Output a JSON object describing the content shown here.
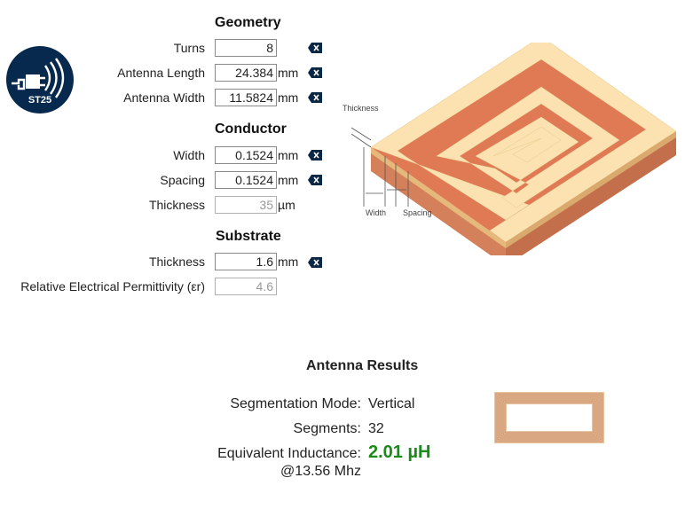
{
  "logo": {
    "text": "ST25"
  },
  "geometry": {
    "title": "Geometry",
    "turns": {
      "label": "Turns",
      "value": "8"
    },
    "length": {
      "label": "Antenna Length",
      "value": "24.384",
      "unit": "mm"
    },
    "width": {
      "label": "Antenna Width",
      "value": "11.5824",
      "unit": "mm"
    }
  },
  "conductor": {
    "title": "Conductor",
    "width": {
      "label": "Width",
      "value": "0.1524",
      "unit": "mm"
    },
    "spacing": {
      "label": "Spacing",
      "value": "0.1524",
      "unit": "mm"
    },
    "thickness": {
      "label": "Thickness",
      "value": "35",
      "unit": "µm"
    }
  },
  "substrate": {
    "title": "Substrate",
    "thickness": {
      "label": "Thickness",
      "value": "1.6",
      "unit": "mm"
    },
    "permittivity": {
      "label": "Relative Electrical Permittivity (εr)",
      "value": "4.6"
    }
  },
  "diagram": {
    "thickness_label": "Thickness",
    "width_label": "Width",
    "spacing_label": "Spacing"
  },
  "results": {
    "title": "Antenna Results",
    "segmentation_mode": {
      "label": "Segmentation Mode:",
      "value": "Vertical"
    },
    "segments": {
      "label": "Segments:",
      "value": "32"
    },
    "inductance": {
      "label": "Equivalent Inductance:",
      "value": "2.01 µH",
      "sub": "@13.56 Mhz"
    }
  },
  "colors": {
    "logo_bg": "#07294d",
    "result_green": "#1a8a1a",
    "copper_top": "#fbe2b0",
    "copper_side": "#d4805a",
    "substrate_top": "#e0714f"
  },
  "icons": {
    "clear": "backspace-x-icon"
  }
}
